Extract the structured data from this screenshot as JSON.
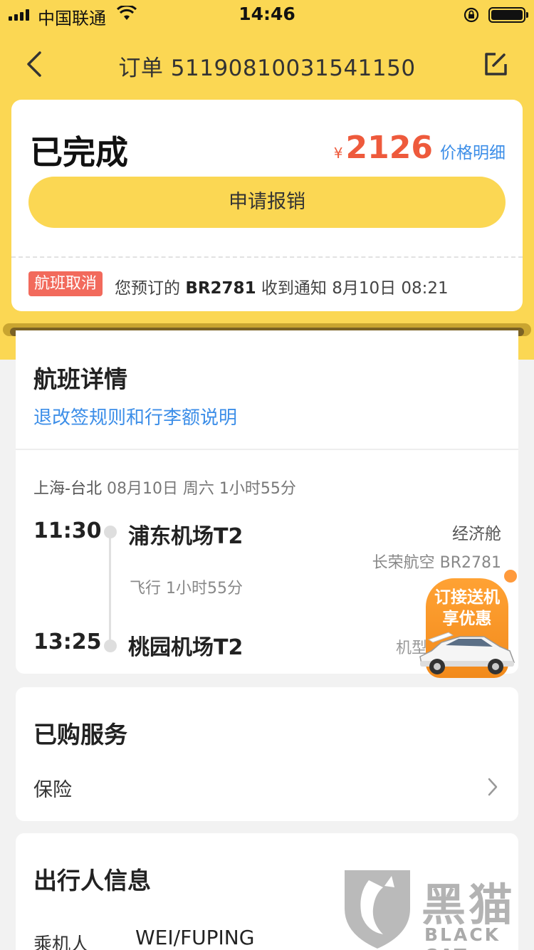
{
  "status_bar": {
    "carrier": "中国联通",
    "time": "14:46"
  },
  "nav": {
    "title": "订单 51190810031541150"
  },
  "order_status": {
    "title": "已完成",
    "currency": "¥",
    "price": "2126",
    "price_detail": "价格明细",
    "reimburse_label": "申请报销",
    "cancel_badge": "航班取消",
    "notice_prefix": "您预订的",
    "flight_no": "BR2781",
    "notice_suffix": "收到通知 8月10日 08:21"
  },
  "flight_details": {
    "title": "航班详情",
    "rules_link": "退改签规则和行李额说明",
    "route": "上海-台北",
    "route_meta": "08月10日 周六 1小时55分",
    "dep_time": "11:30",
    "dep_airport": "浦东机场T2",
    "duration": "飞行 1小时55分",
    "arr_time": "13:25",
    "arr_airport": "桃园机场T2",
    "cabin": "经济舱",
    "airline": "长荣航空 BR2781",
    "aircraft": "机型"
  },
  "promo": {
    "line1": "订接送机",
    "line2": "享优惠"
  },
  "services": {
    "title": "已购服务",
    "insurance_label": "保险"
  },
  "passenger": {
    "title": "出行人信息",
    "label": "乘机人",
    "name": "WEI/FUPING"
  },
  "watermark": {
    "cn": "黑猫",
    "en": "BLACK CAT"
  },
  "colors": {
    "brand_yellow": "#fbd753",
    "price_red": "#ee5a3c",
    "link_blue": "#3c8ee8",
    "cancel_red": "#f26a5c",
    "promo_orange": "#f28a1b"
  }
}
